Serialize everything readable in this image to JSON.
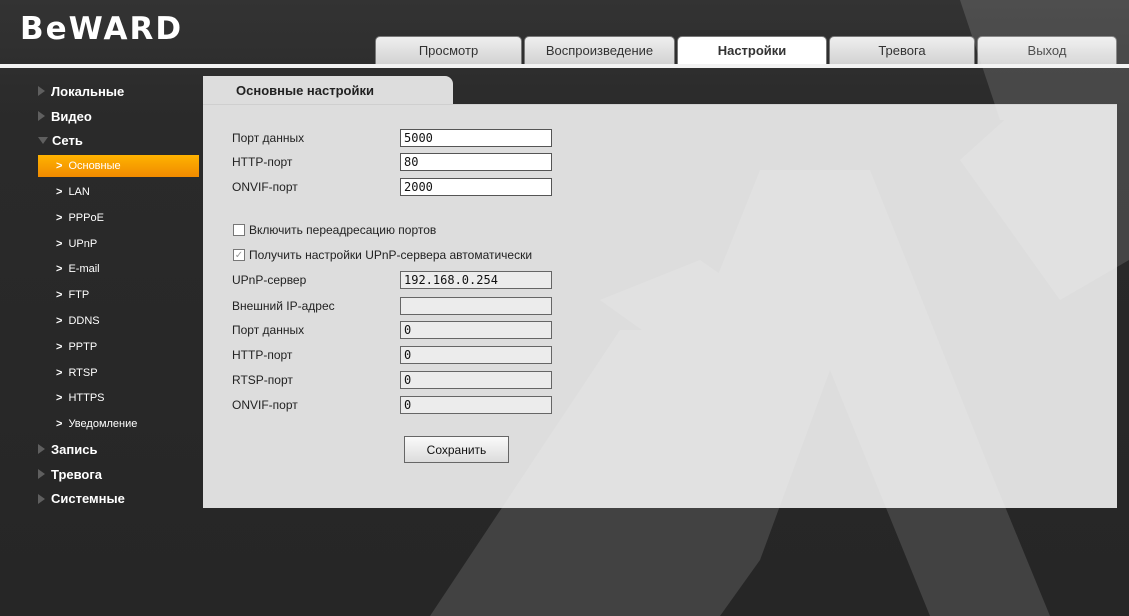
{
  "brand": {
    "logo_text": "BeWARD",
    "accent": "#f59a00"
  },
  "tabs": [
    {
      "label": "Просмотр",
      "active": false
    },
    {
      "label": "Воспроизведение",
      "active": false
    },
    {
      "label": "Настройки",
      "active": true
    },
    {
      "label": "Тревога",
      "active": false
    },
    {
      "label": "Выход",
      "active": false
    }
  ],
  "sidebar": {
    "groups": [
      {
        "label": "Локальные",
        "expanded": false
      },
      {
        "label": "Видео",
        "expanded": false
      },
      {
        "label": "Сеть",
        "expanded": true,
        "items": [
          "Основные",
          "LAN",
          "PPPoE",
          "UPnP",
          "E-mail",
          "FTP",
          "DDNS",
          "PPTP",
          "RTSP",
          "HTTPS",
          "Уведомление"
        ],
        "active_item": "Основные"
      },
      {
        "label": "Запись",
        "expanded": false
      },
      {
        "label": "Тревога",
        "expanded": false
      },
      {
        "label": "Системные",
        "expanded": false
      }
    ]
  },
  "panel": {
    "title": "Основные настройки",
    "fields_top": [
      {
        "label": "Порт данных",
        "value": "5000"
      },
      {
        "label": "HTTP-порт",
        "value": "80"
      },
      {
        "label": "ONVIF-порт",
        "value": "2000"
      }
    ],
    "port_forward": {
      "label": "Включить переадресацию портов",
      "checked": false
    },
    "upnp_auto": {
      "label": "Получить настройки UPnP-сервера автоматически",
      "checked": true
    },
    "fields_upnp": [
      {
        "label": "UPnP-сервер",
        "value": "192.168.0.254"
      },
      {
        "label": "Внешний IP-адрес",
        "value": ""
      },
      {
        "label": "Порт данных",
        "value": "0"
      },
      {
        "label": "HTTP-порт",
        "value": "0"
      },
      {
        "label": "RTSP-порт",
        "value": "0"
      },
      {
        "label": "ONVIF-порт",
        "value": "0"
      }
    ],
    "save_label": "Сохранить"
  }
}
